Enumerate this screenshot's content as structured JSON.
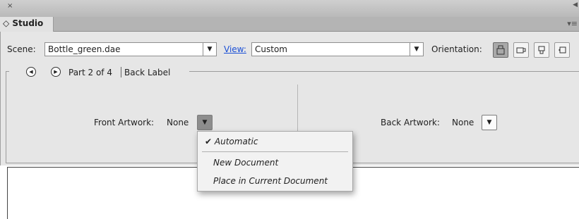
{
  "window": {
    "close_glyph": "×"
  },
  "tab": {
    "label": "◇ Studio",
    "menu_glyph": "▾≡"
  },
  "scene": {
    "label": "Scene:",
    "value": "Bottle_green.dae"
  },
  "view": {
    "label": "View:",
    "value": "Custom"
  },
  "orientation": {
    "label": "Orientation:",
    "icons": [
      "orientation-front-icon",
      "orientation-side-icon",
      "orientation-top-icon",
      "orientation-rotate-icon"
    ]
  },
  "part": {
    "label": "Part 2 of 4",
    "name": "Back Label"
  },
  "front_artwork": {
    "label": "Front Artwork:",
    "value": "None"
  },
  "back_artwork": {
    "label": "Back Artwork:",
    "value": "None"
  },
  "menu": {
    "items": [
      {
        "label": "Automatic",
        "checked": true,
        "check_glyph": "✔"
      },
      {
        "label": "New Document"
      },
      {
        "label": "Place in Current Document"
      }
    ]
  },
  "colors": {
    "panel": "#e6e6e6",
    "link": "#1a4fd6",
    "selected_button": "#a9a9a9"
  }
}
